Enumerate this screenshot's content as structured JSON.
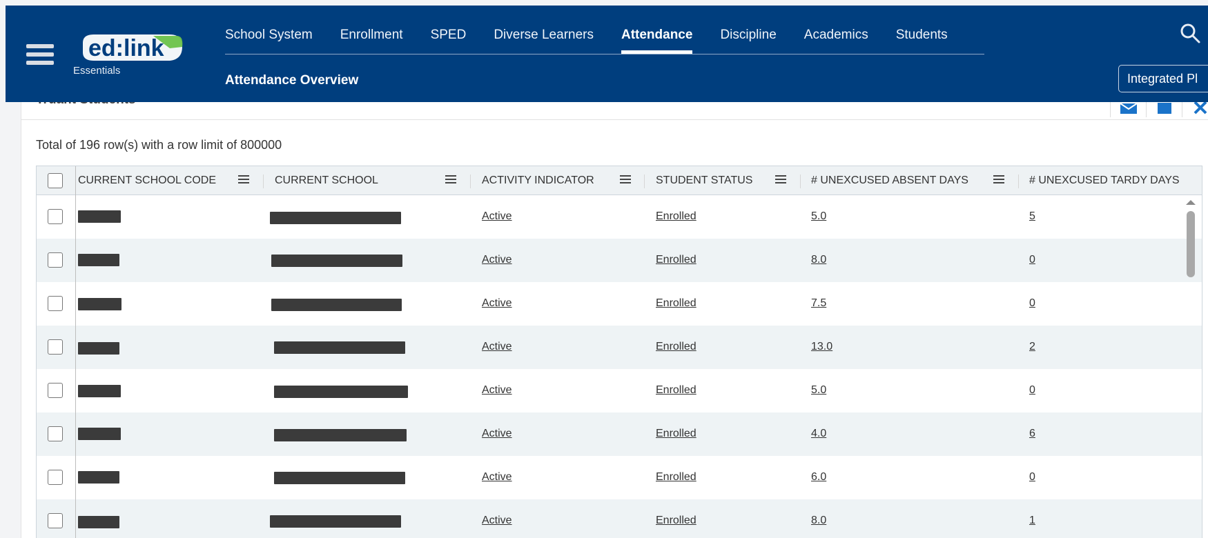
{
  "app": {
    "logo_text": "ed:link",
    "logo_sub": "Essentials"
  },
  "nav": {
    "items": [
      {
        "label": "School System"
      },
      {
        "label": "Enrollment"
      },
      {
        "label": "SPED"
      },
      {
        "label": "Diverse Learners"
      },
      {
        "label": "Attendance",
        "active": true
      },
      {
        "label": "Discipline"
      },
      {
        "label": "Academics"
      },
      {
        "label": "Students"
      }
    ],
    "sub_item": "Attendance Overview",
    "integrated_button": "Integrated Pl"
  },
  "report": {
    "title": "Truant Students",
    "row_count_text": "Total of 196 row(s) with a row limit of 800000"
  },
  "table": {
    "columns": [
      "CURRENT SCHOOL CODE",
      "CURRENT SCHOOL",
      "ACTIVITY INDICATOR",
      "STUDENT STATUS",
      "# UNEXCUSED ABSENT DAYS",
      "# UNEXCUSED TARDY DAYS"
    ],
    "rows": [
      {
        "activity": "Active",
        "status": "Enrolled",
        "absent": "5.0",
        "tardy": "5"
      },
      {
        "activity": "Active",
        "status": "Enrolled",
        "absent": "8.0",
        "tardy": "0"
      },
      {
        "activity": "Active",
        "status": "Enrolled",
        "absent": "7.5",
        "tardy": "0"
      },
      {
        "activity": "Active",
        "status": "Enrolled",
        "absent": "13.0",
        "tardy": "2"
      },
      {
        "activity": "Active",
        "status": "Enrolled",
        "absent": "5.0",
        "tardy": "0"
      },
      {
        "activity": "Active",
        "status": "Enrolled",
        "absent": "4.0",
        "tardy": "6"
      },
      {
        "activity": "Active",
        "status": "Enrolled",
        "absent": "6.0",
        "tardy": "0"
      },
      {
        "activity": "Active",
        "status": "Enrolled",
        "absent": "8.0",
        "tardy": "1"
      }
    ]
  },
  "colors": {
    "header_bg": "#003e7e",
    "row_alt": "#eef3f5",
    "logo_green": "#6cc24a"
  }
}
